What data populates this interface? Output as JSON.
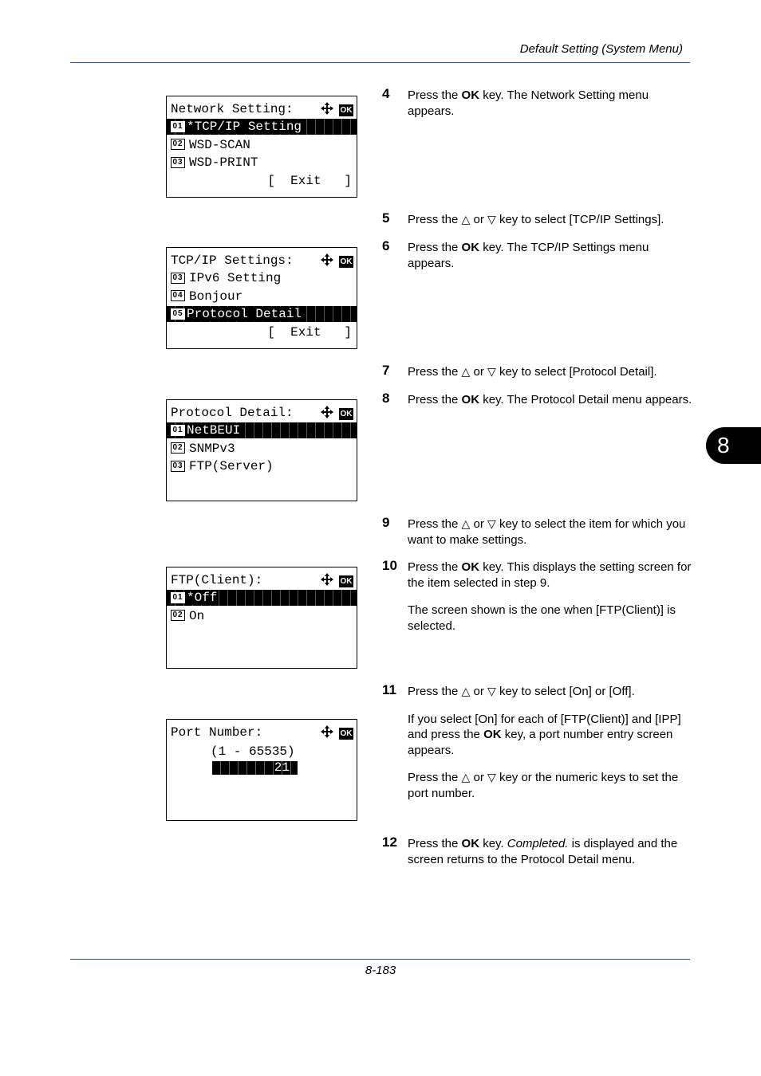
{
  "header": {
    "title": "Default Setting (System Menu)"
  },
  "footer": {
    "page_number": "8-183"
  },
  "chapter_tab": "8",
  "icons": {
    "nav": "four-way-arrow-icon",
    "ok": "OK"
  },
  "screens": [
    {
      "title": "Network Setting:",
      "rows": [
        {
          "num": "01",
          "text": "*TCP/IP Setting",
          "selected": true
        },
        {
          "num": "02",
          "text": "WSD-SCAN",
          "selected": false
        },
        {
          "num": "03",
          "text": "WSD-PRINT",
          "selected": false
        }
      ],
      "exit": "[  Exit   ]"
    },
    {
      "title": "TCP/IP Settings:",
      "rows": [
        {
          "num": "03",
          "text": "IPv6 Setting",
          "selected": false
        },
        {
          "num": "04",
          "text": "Bonjour",
          "selected": false
        },
        {
          "num": "05",
          "text": "Protocol Detail",
          "selected": true
        }
      ],
      "exit": "[  Exit   ]"
    },
    {
      "title": "Protocol Detail:",
      "rows": [
        {
          "num": "01",
          "text": "NetBEUI",
          "selected": true
        },
        {
          "num": "02",
          "text": "SNMPv3",
          "selected": false
        },
        {
          "num": "03",
          "text": "FTP(Server)",
          "selected": false
        }
      ]
    },
    {
      "title": "FTP(Client):",
      "rows": [
        {
          "num": "01",
          "text": "*Off",
          "selected": true
        },
        {
          "num": "02",
          "text": "On",
          "selected": false
        }
      ]
    },
    {
      "title": "Port Number:",
      "range": "(1 - 65535)",
      "value": "21"
    }
  ],
  "steps": [
    {
      "n": "4",
      "paras": [
        [
          "Press the ",
          {
            "b": "OK"
          },
          " key. The Network Setting menu appears."
        ]
      ]
    },
    {
      "n": "5",
      "paras": [
        [
          "Press the ",
          {
            "tri": "△"
          },
          " or ",
          {
            "tri": "▽"
          },
          " key to select [TCP/IP Settings]."
        ]
      ]
    },
    {
      "n": "6",
      "paras": [
        [
          "Press the ",
          {
            "b": "OK"
          },
          " key. The TCP/IP Settings menu appears."
        ]
      ]
    },
    {
      "n": "7",
      "paras": [
        [
          "Press the ",
          {
            "tri": "△"
          },
          " or ",
          {
            "tri": "▽"
          },
          " key to select [Protocol Detail]."
        ]
      ]
    },
    {
      "n": "8",
      "paras": [
        [
          "Press the ",
          {
            "b": "OK"
          },
          " key. The Protocol Detail menu appears."
        ]
      ]
    },
    {
      "n": "9",
      "paras": [
        [
          "Press the ",
          {
            "tri": "△"
          },
          " or ",
          {
            "tri": "▽"
          },
          " key to select the item for which you want to make settings."
        ]
      ]
    },
    {
      "n": "10",
      "paras": [
        [
          "Press the ",
          {
            "b": "OK"
          },
          " key. This displays the setting screen for the item selected in step 9."
        ],
        [
          "The screen shown is the one when [FTP(Client)] is selected."
        ]
      ]
    },
    {
      "n": "11",
      "paras": [
        [
          "Press the ",
          {
            "tri": "△"
          },
          " or ",
          {
            "tri": "▽"
          },
          " key to select [On] or [Off]."
        ],
        [
          "If you select [On] for each of [FTP(Client)] and [IPP] and press the ",
          {
            "b": "OK"
          },
          " key, a port number entry screen appears."
        ],
        [
          "Press the ",
          {
            "tri": "△"
          },
          " or ",
          {
            "tri": "▽"
          },
          " key or the numeric keys to set the port number."
        ]
      ]
    },
    {
      "n": "12",
      "paras": [
        [
          "Press the ",
          {
            "b": "OK"
          },
          " key. ",
          {
            "i": "Completed."
          },
          " is displayed and the screen returns to the Protocol Detail menu."
        ]
      ]
    }
  ]
}
